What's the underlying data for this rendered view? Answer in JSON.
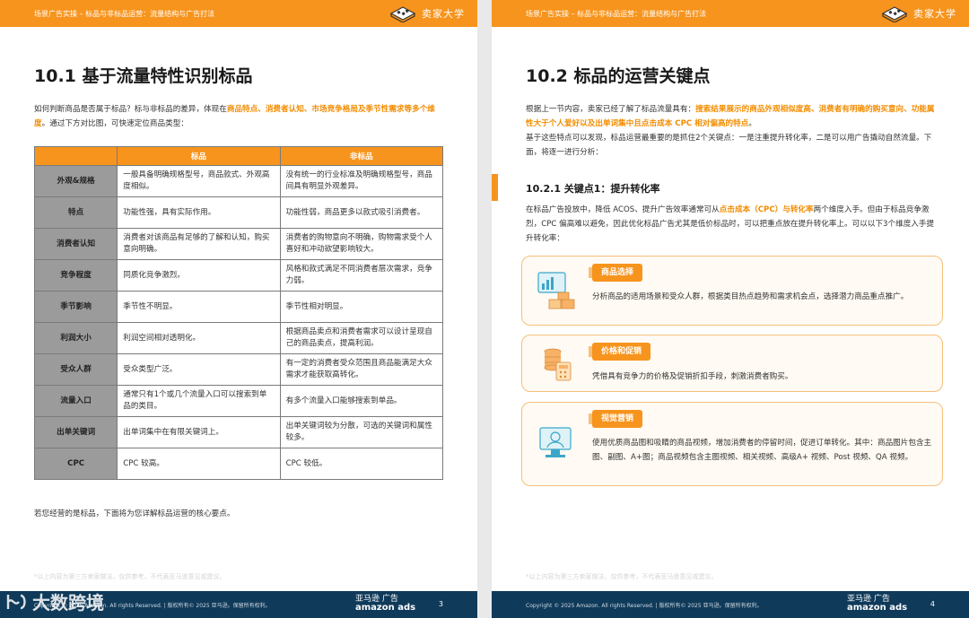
{
  "header": {
    "crumb": "场景广告实操 – 标品与非标品运营：流量结构与广告打法",
    "brand": "卖家大学"
  },
  "left": {
    "title": "10.1 基于流量特性识别标品",
    "intro": {
      "p1": "如何判断商品是否属于标品？标与非标品的差异，体现在",
      "hl": "商品特点、消费者认知、市场竞争格局及季节性需求等多个维度",
      "p2": "。通过下方对比图，可快速定位商品类型："
    },
    "table": {
      "headers": [
        "",
        "标品",
        "非标品"
      ],
      "rows": [
        {
          "label": "外观&规格",
          "std": "一般具备明确规格型号，商品款式、外观高度相似。",
          "nonstd": "没有统一的行业标准及明确规格型号，商品间具有明显外观差异。"
        },
        {
          "label": "特点",
          "std": "功能性强，具有实际作用。",
          "nonstd": "功能性弱，商品更多以款式吸引消费者。"
        },
        {
          "label": "消费者认知",
          "std": "消费者对该商品有足够的了解和认知，购买意向明确。",
          "nonstd": "消费者的购物意向不明确，购物需求受个人喜好和冲动欲望影响较大。"
        },
        {
          "label": "竞争程度",
          "std": "同质化竞争激烈。",
          "nonstd": "风格和款式满足不同消费者层次需求，竞争力弱。"
        },
        {
          "label": "季节影响",
          "std": "季节性不明显。",
          "nonstd": "季节性相对明显。"
        },
        {
          "label": "利润大小",
          "std": "利润空间相对透明化。",
          "nonstd": "根据商品卖点和消费者需求可以设计呈现自己的商品卖点，提高利润。"
        },
        {
          "label": "受众人群",
          "std": "受众类型广泛。",
          "nonstd": "有一定的消费者受众范围且商品能满足大众需求才能获取高转化。"
        },
        {
          "label": "流量入口",
          "std": "通常只有1个或几个流量入口可以搜索到单品的类目。",
          "nonstd": "有多个流量入口能够搜索到单品。"
        },
        {
          "label": "出单关键词",
          "std": "出单词集中在有限关键词上。",
          "nonstd": "出单关键词较为分散，可选的关键词和属性较多。"
        },
        {
          "label": "CPC",
          "std": "CPC 较高。",
          "nonstd": "CPC 较低。"
        }
      ]
    },
    "closing": "若您经营的是标品，下面将为您详解标品运营的核心要点。",
    "footnote": "*以上内容为第三方卖家做法，仅供参考，不代表亚马逊意见或建议。",
    "copyright": "Copyright © 2025 Amazon. All rights Reserved. | 版权所有© 2025 亚马逊。保留所有权利。",
    "page_number": "3"
  },
  "right": {
    "title": "10.2 标品的运营关键点",
    "intro": {
      "p1": "根据上一节内容，卖家已经了解了标品流量具有：",
      "hl": "搜索结果展示的商品外观相似度高、消费者有明确的购买意向、功能属性大于个人爱好以及出单词集中且点击成本 CPC 相对偏高的特点",
      "p2": "。",
      "p3": "基于这些特点可以发现，标品运营最重要的是抓住2个关键点：一是注重提升转化率，二是可以用广告撬动自然流量。下面，将逐一进行分析："
    },
    "section": {
      "title": "10.2.1 关键点1：提升转化率",
      "p1": "在标品广告投放中，降低 ACOS、提升广告效率通常可从",
      "hl": "点击成本（CPC）与转化率",
      "p2": "两个维度入手。但由于标品竞争激烈，CPC 偏高难以避免，因此优化标品广告尤其是低价标品时，可以把重点放在提升转化率上。可以以下3个维度入手提升转化率："
    },
    "cards": [
      {
        "tag": "商品选择",
        "icon": "analytics-boxes-icon",
        "text": "分析商品的适用场景和受众人群，根据类目热点趋势和需求机会点，选择潜力商品重点推广。"
      },
      {
        "tag": "价格和促销",
        "icon": "coins-calculator-icon",
        "text": "凭借具有竞争力的价格及促销折扣手段，刺激消费者购买。"
      },
      {
        "tag": "视觉营销",
        "icon": "monitor-video-icon",
        "text": "使用优质商品图和吸睛的商品视频，增加消费者的停留时间，促进订单转化。其中：商品图片包含主图、副图、A+图；商品视频包含主图视频、相关视频、高级A+ 视频、Post 视频、QA 视频。"
      }
    ],
    "footnote": "*以上内容为第三方卖家做法，仅供参考，不代表亚马逊意见或建议。",
    "copyright": "Copyright © 2025 Amazon. All rights Reserved. | 版权所有© 2025 亚马逊。保留所有权利。",
    "page_number": "4"
  },
  "footer_brand": {
    "cn": "亚马逊 广告",
    "en": "amazon ads"
  },
  "watermark": "大数跨境",
  "colors": {
    "accent": "#f7941d",
    "footer": "#0f3a5a",
    "row_head": "#9b9b9b"
  }
}
